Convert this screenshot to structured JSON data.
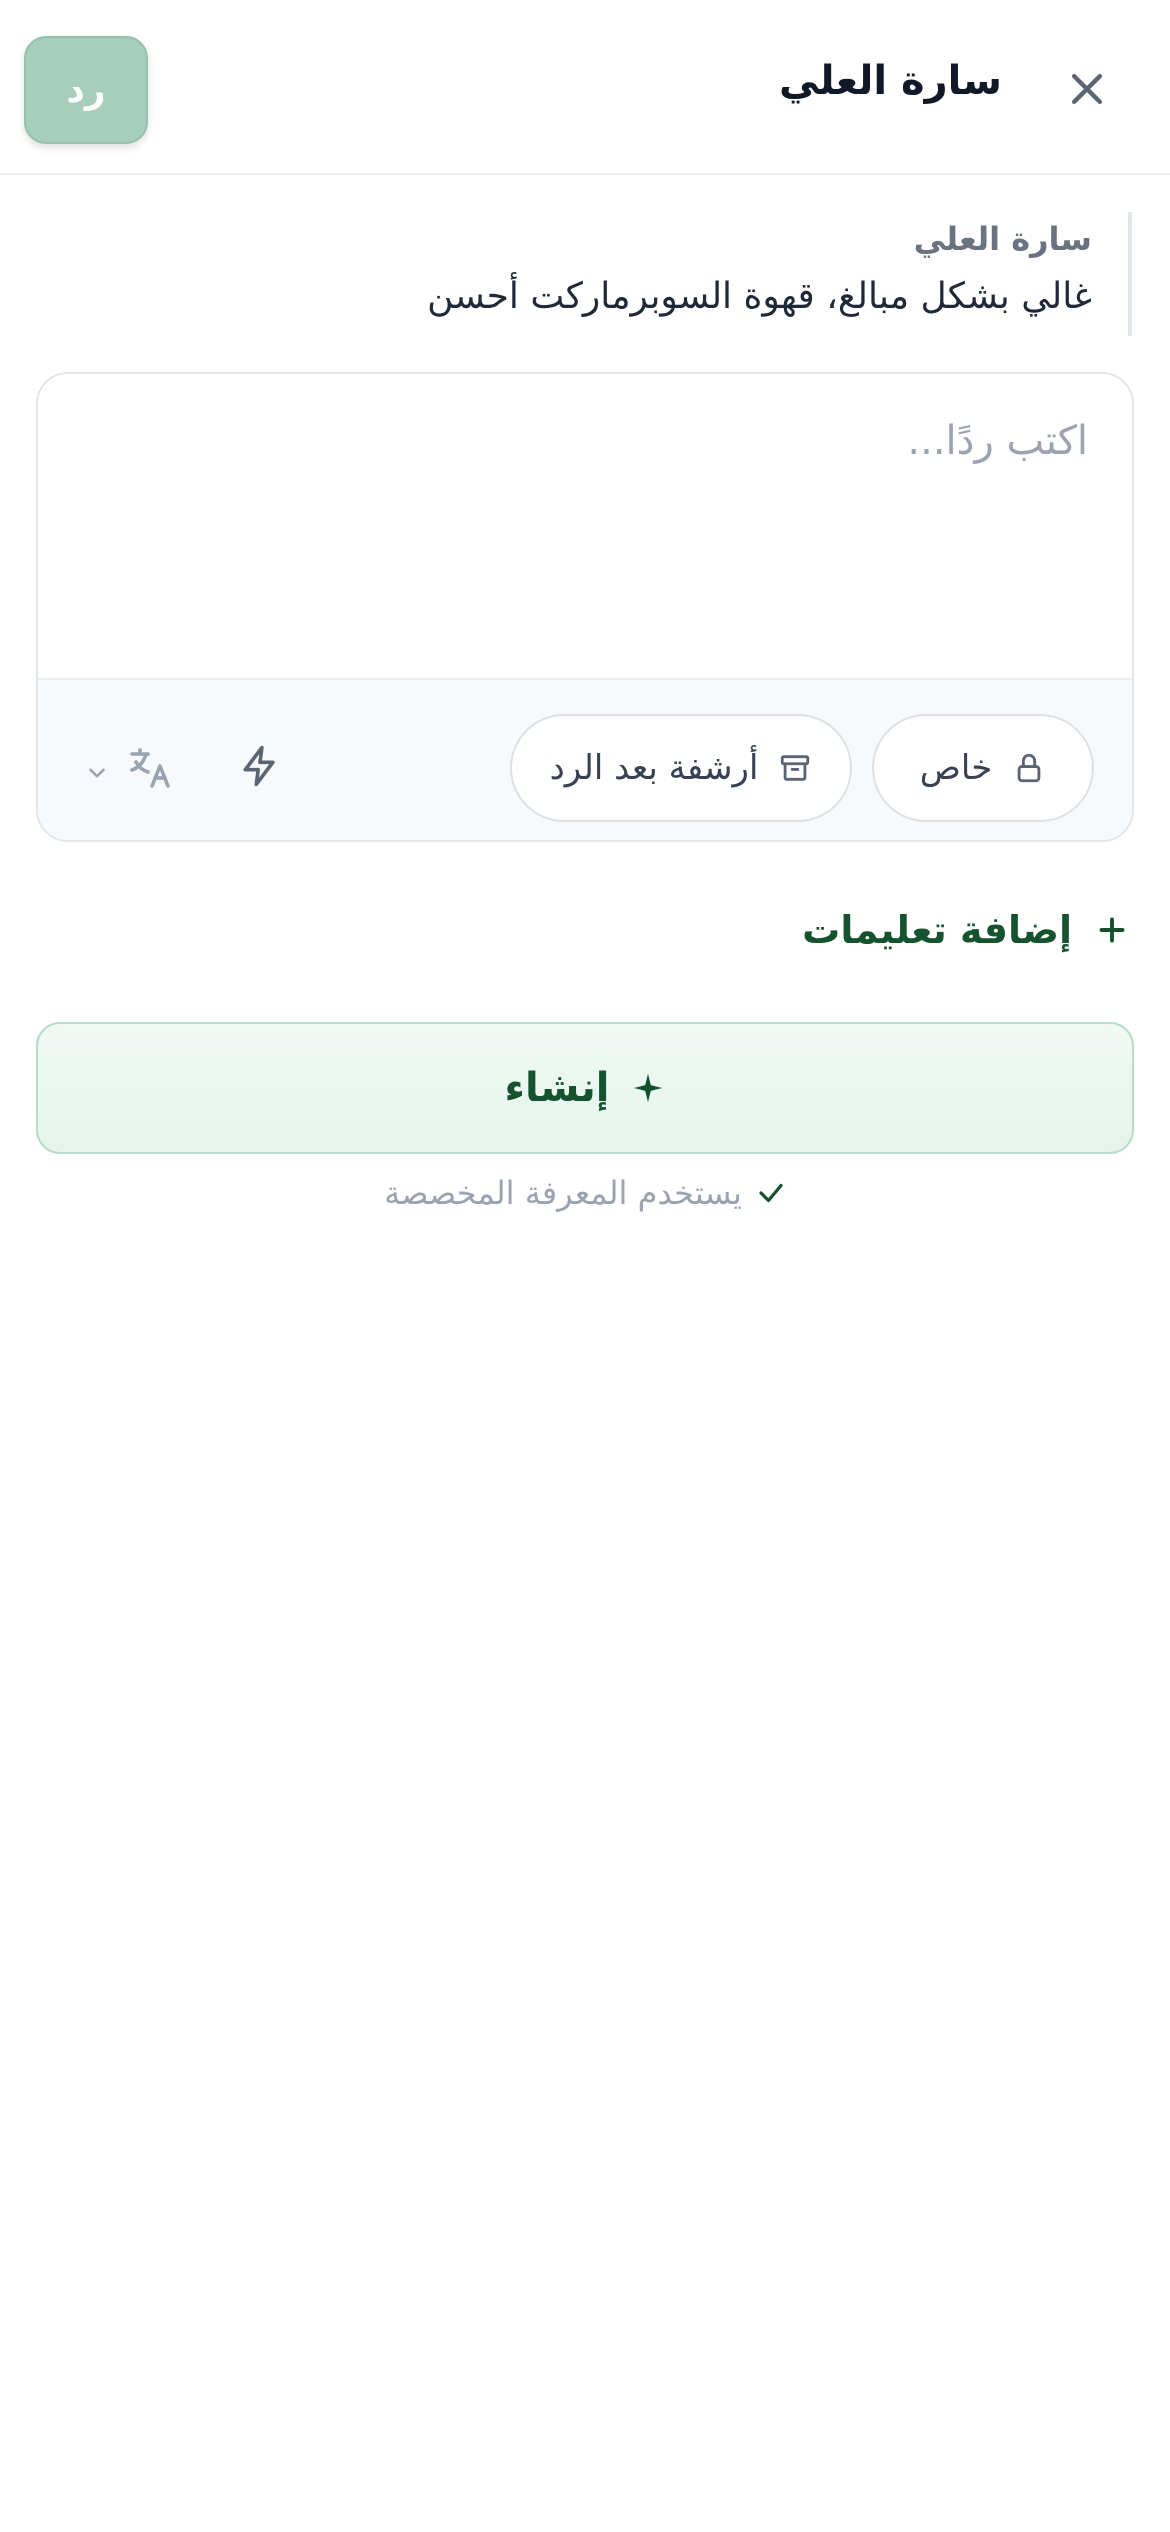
{
  "header": {
    "title": "سارة العلي",
    "reply_label": "رد",
    "close_icon": "close-icon"
  },
  "quote": {
    "author": "سارة العلي",
    "text": "غالي بشكل مبالغ، قهوة السوبرماركت أحسن"
  },
  "composer": {
    "placeholder": "اكتب ردًا...",
    "value": "",
    "private_label": "خاص",
    "archive_label": "أرشفة بعد الرد",
    "icons": [
      "lock-icon",
      "archive-icon",
      "bolt-icon",
      "translate-icon",
      "chevron-down-icon"
    ]
  },
  "instructions": {
    "add_label": "إضافة تعليمات"
  },
  "generate": {
    "label": "إنشاء",
    "note": "يستخدم المعرفة المخصصة"
  },
  "colors": {
    "brand_green": "#14532d",
    "reply_button_bg": "#a7cdbd",
    "generate_bg": "#e6f4ec"
  }
}
